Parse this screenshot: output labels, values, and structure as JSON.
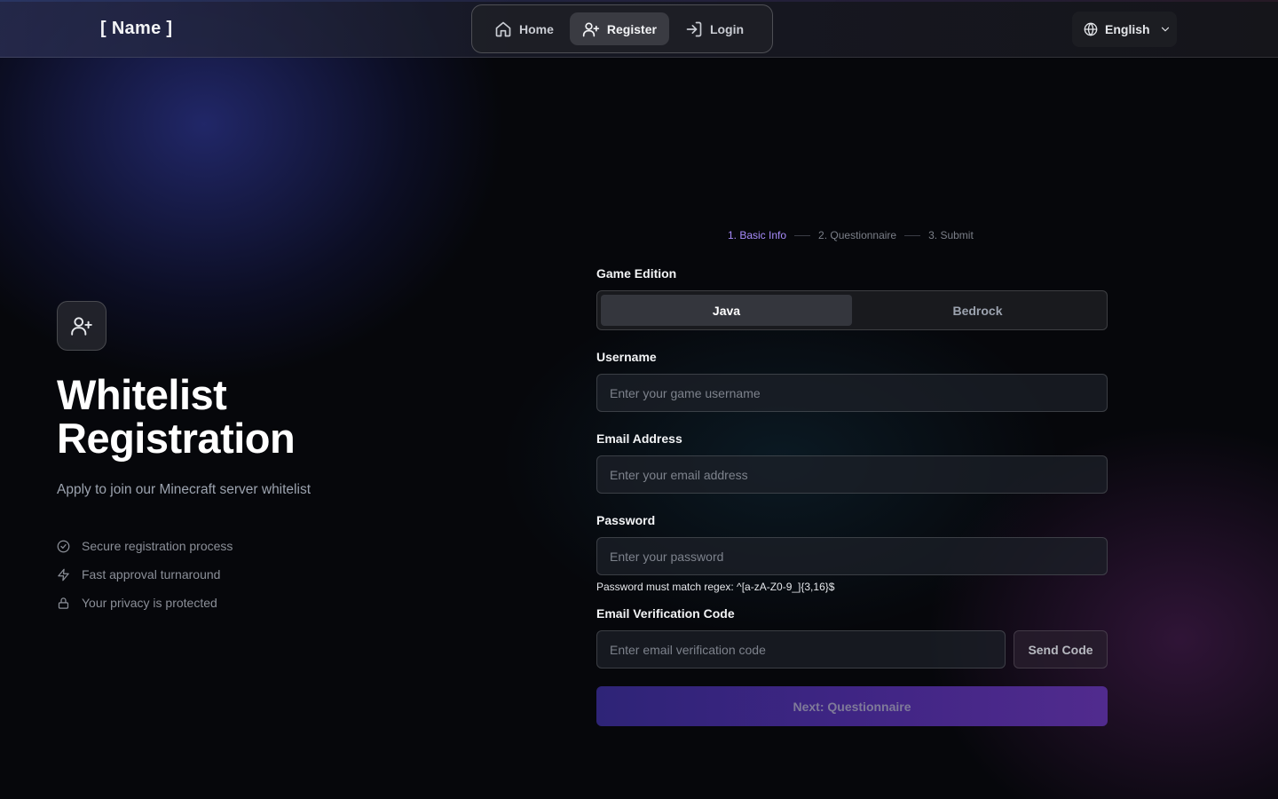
{
  "header": {
    "brand": "[ Name ]",
    "nav": [
      {
        "label": "Home",
        "icon": "home-icon"
      },
      {
        "label": "Register",
        "icon": "user-plus-icon",
        "active": true
      },
      {
        "label": "Login",
        "icon": "log-in-icon"
      }
    ],
    "language": {
      "label": "English",
      "icon": "globe-icon"
    }
  },
  "hero": {
    "icon": "user-plus-icon",
    "title_line1": "Whitelist",
    "title_line2": "Registration",
    "subtitle": "Apply to join our Minecraft server whitelist",
    "features": [
      {
        "label": "Secure registration process",
        "icon": "check-circle-icon"
      },
      {
        "label": "Fast approval turnaround",
        "icon": "zap-icon"
      },
      {
        "label": "Your privacy is protected",
        "icon": "lock-icon"
      }
    ]
  },
  "steps": [
    "1. Basic Info",
    "2. Questionnaire",
    "3. Submit"
  ],
  "form": {
    "edition": {
      "label": "Game Edition",
      "options": [
        "Java",
        "Bedrock"
      ],
      "selected": "Java"
    },
    "username": {
      "label": "Username",
      "placeholder": "Enter your game username",
      "value": ""
    },
    "email": {
      "label": "Email Address",
      "placeholder": "Enter your email address",
      "value": ""
    },
    "password": {
      "label": "Password",
      "placeholder": "Enter your password",
      "value": "",
      "hint": "Password must match regex: ^[a-zA-Z0-9_]{3,16}$"
    },
    "verification": {
      "label": "Email Verification Code",
      "placeholder": "Enter email verification code",
      "value": "",
      "send_label": "Send Code"
    },
    "next_label": "Next: Questionnaire"
  },
  "colors": {
    "accent": "#a78bfa",
    "button_start": "#2e2477",
    "button_end": "#512b8e"
  }
}
